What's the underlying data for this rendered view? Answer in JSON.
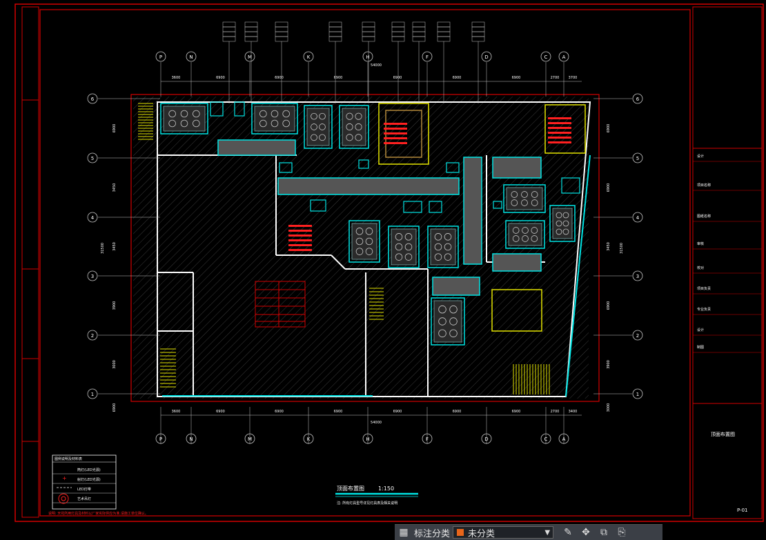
{
  "drawing": {
    "grid_columns": [
      "P",
      "N",
      "M",
      "K",
      "H",
      "F",
      "D",
      "C",
      "A"
    ],
    "grid_rows": [
      "6",
      "5",
      "4",
      "3",
      "2",
      "1"
    ],
    "top_dims": [
      "3600",
      "6900",
      "6900",
      "6900",
      "6900",
      "6900",
      "6900",
      "2700",
      "3700"
    ],
    "top_total": "54000",
    "bottom_dims": [
      "3600",
      "6900",
      "6900",
      "6900",
      "6900",
      "6900",
      "6900",
      "2700",
      "3400"
    ],
    "bottom_total": "54000",
    "left_dims": [
      "6900",
      "3450",
      "3450",
      "3900",
      "3000",
      "6900"
    ],
    "left_total": "31500",
    "right_dims": [
      "6900",
      "6900",
      "3450",
      "6900",
      "3900",
      "3000"
    ],
    "right_total": "31500",
    "title": "顶面布置图",
    "scale": "1:150",
    "note": "注: 所有灯具型号详见灯具表及相关说明",
    "legend_title": "图例说明及材料表",
    "legend_items": [
      {
        "label": "筒灯(LED光源)"
      },
      {
        "label": "射灯(LED光源)"
      },
      {
        "label": "LED灯带"
      },
      {
        "label": "艺术吊灯"
      }
    ],
    "legend_note": "说明: 天花所用灯具及材料以厂家实际供应为准,请施工单位确认。",
    "title_block": {
      "sheet_title": "顶面布置图",
      "sheet_no": "P-01",
      "rows": [
        "设计",
        "项目名称",
        "图纸名称",
        "审核",
        "校对",
        "项目负责",
        "专业负责",
        "设计",
        "制图"
      ]
    },
    "colors": {
      "frame": "#d40000",
      "wall": "#ffffff",
      "cyan": "#00e5e5",
      "yellow": "#e6e600",
      "red_text": "#ff2020",
      "grid_line": "#c8c8c8"
    }
  },
  "toolbar": {
    "layers_icon": "layers-icon",
    "label": "标注分类",
    "select_value": "未分类",
    "swatch_color": "#e8651a",
    "tools": [
      "edit-icon",
      "move-icon",
      "copy-icon",
      "paste-icon"
    ]
  }
}
